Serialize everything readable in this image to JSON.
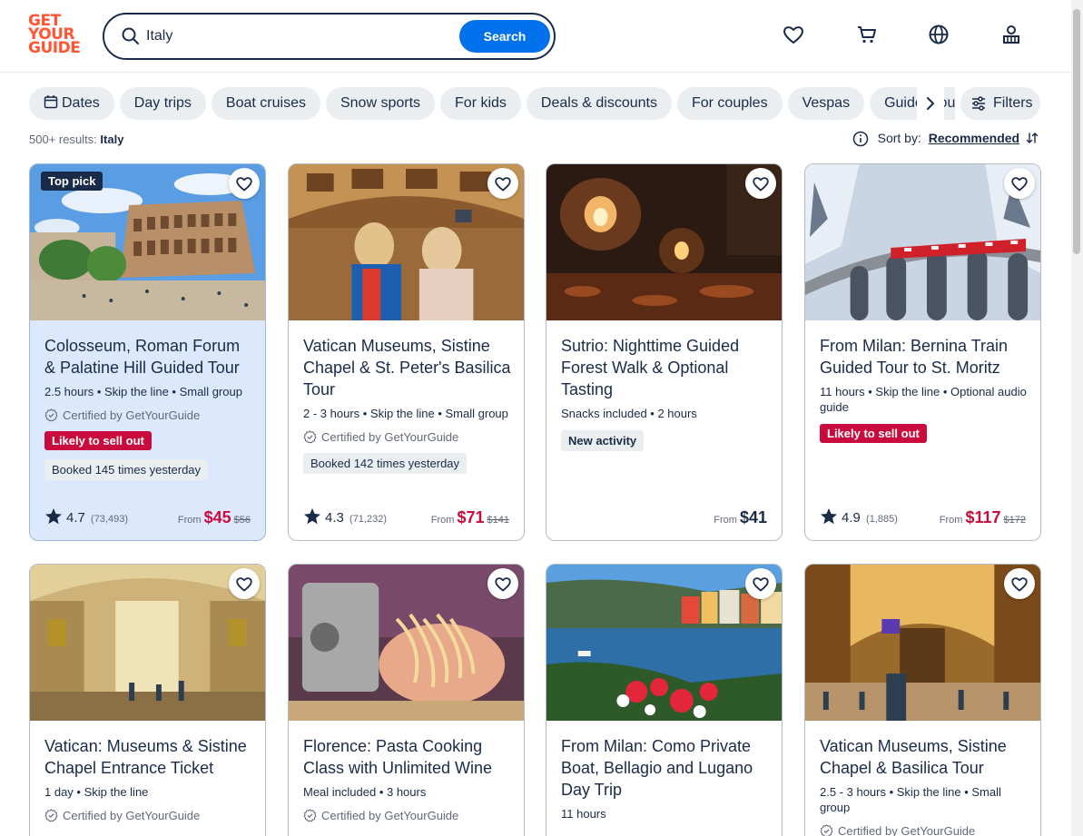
{
  "header": {
    "logo_lines": [
      "GET",
      "YOUR",
      "GUIDE"
    ],
    "search_value": "Italy",
    "search_button": "Search",
    "brand_color": "#ff5533",
    "accent_color": "#0071eb",
    "icons": [
      "heart-icon",
      "cart-icon",
      "globe-icon",
      "profile-icon"
    ]
  },
  "filters": {
    "chips": [
      "Dates",
      "Day trips",
      "Boat cruises",
      "Snow sports",
      "For kids",
      "Deals & discounts",
      "For couples",
      "Vespas",
      "Guided tours"
    ],
    "filters_label": "Filters"
  },
  "results": {
    "count": "500+ results:",
    "query": "Italy",
    "sort_label": "Sort by:",
    "sort_value": "Recommended"
  },
  "cards": [
    {
      "badge_top": "Top pick",
      "title": "Colosseum, Roman Forum & Palatine Hill Guided Tour",
      "meta": "2.5 hours • Skip the line • Small group",
      "certified": "Certified by GetYourGuide",
      "red_badge": "Likely to sell out",
      "grey_badge": "Booked 145 times yesterday",
      "rating": "4.7",
      "reviews": "(73,493)",
      "from": "From",
      "price": "$45",
      "old_price": "$56"
    },
    {
      "title": "Vatican Museums, Sistine Chapel & St. Peter's Basilica Tour",
      "meta": "2 - 3 hours • Skip the line • Small group",
      "certified": "Certified by GetYourGuide",
      "grey_badge": "Booked 142 times yesterday",
      "rating": "4.3",
      "reviews": "(71,232)",
      "from": "From",
      "price": "$71",
      "old_price": "$141"
    },
    {
      "title": "Sutrio: Nighttime Guided Forest Walk & Optional Tasting",
      "meta": "Snacks included • 2 hours",
      "grey_badge": "New activity",
      "from": "From",
      "price": "$41"
    },
    {
      "title": "From Milan: Bernina Train Guided Tour to St. Moritz",
      "meta": "11 hours • Skip the line • Optional audio guide",
      "red_badge": "Likely to sell out",
      "rating": "4.9",
      "reviews": "(1,885)",
      "from": "From",
      "price": "$117",
      "old_price": "$172"
    },
    {
      "title": "Vatican: Museums & Sistine Chapel Entrance Ticket",
      "meta": "1 day • Skip the line",
      "certified": "Certified by GetYourGuide"
    },
    {
      "title": "Florence: Pasta Cooking Class with Unlimited Wine",
      "meta": "Meal included • 3 hours",
      "certified": "Certified by GetYourGuide"
    },
    {
      "title": "From Milan: Como Private Boat, Bellagio and Lugano Day Trip",
      "meta": "11 hours"
    },
    {
      "title": "Vatican Museums, Sistine Chapel & Basilica Tour",
      "meta": "2.5 - 3 hours • Skip the line • Small group",
      "certified": "Certified by GetYourGuide"
    }
  ]
}
